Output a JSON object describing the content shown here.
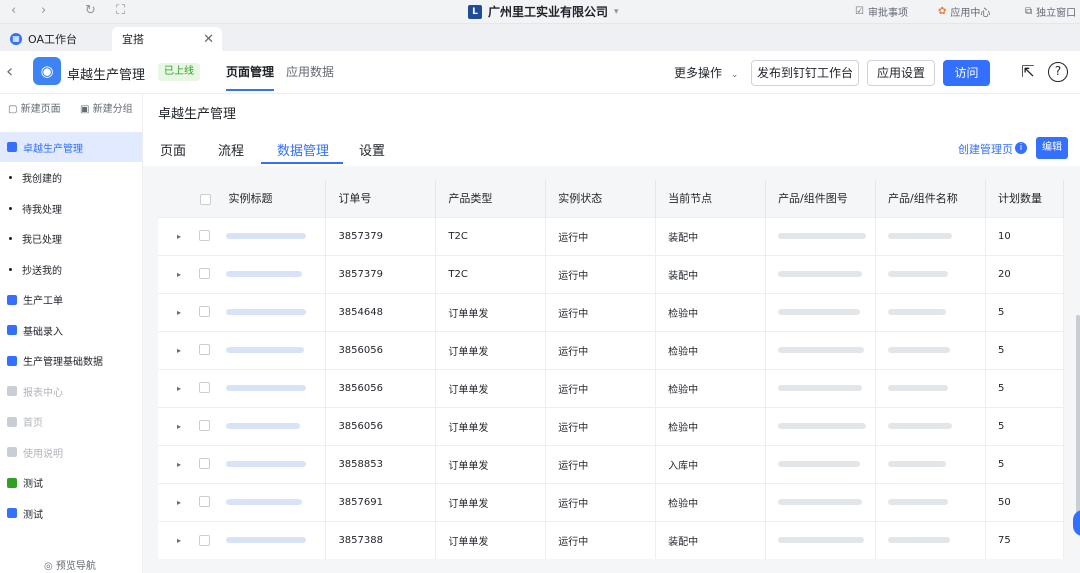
{
  "titlebar": {
    "company": "广州里工实业有限公司",
    "right_items": [
      {
        "label": "审批事项",
        "icon": "approval-icon"
      },
      {
        "label": "应用中心",
        "icon": "app-center-icon"
      },
      {
        "label": "独立窗口",
        "icon": "window-icon"
      }
    ]
  },
  "tabs": [
    {
      "label": "OA工作台",
      "active": false
    },
    {
      "label": "宜搭",
      "active": true
    }
  ],
  "header": {
    "app_name": "卓越生产管理",
    "status_badge": "已上线",
    "nav": [
      {
        "label": "页面管理",
        "active": true
      },
      {
        "label": "应用数据",
        "active": false
      }
    ],
    "more_label": "更多操作",
    "publish_label": "发布到钉钉工作台",
    "settings_label": "应用设置",
    "visit_label": "访问"
  },
  "sidebar": {
    "new_page": "新建页面",
    "new_group": "新建分组",
    "items": [
      {
        "label": "卓越生产管理",
        "type": "group",
        "active": true
      },
      {
        "label": "我创建的",
        "type": "dot"
      },
      {
        "label": "待我处理",
        "type": "dot"
      },
      {
        "label": "我已处理",
        "type": "dot"
      },
      {
        "label": "抄送我的",
        "type": "dot"
      },
      {
        "label": "生产工单",
        "type": "doc"
      },
      {
        "label": "基础录入",
        "type": "folder"
      },
      {
        "label": "生产管理基础数据",
        "type": "folder"
      },
      {
        "label": "报表中心",
        "type": "folder",
        "disabled": true
      },
      {
        "label": "首页",
        "type": "doc",
        "disabled": true
      },
      {
        "label": "使用说明",
        "type": "doc",
        "disabled": true
      },
      {
        "label": "测试",
        "type": "form"
      },
      {
        "label": "测试",
        "type": "doc"
      }
    ],
    "footer": "预览导航"
  },
  "main": {
    "title": "卓越生产管理",
    "subtabs": [
      "页面",
      "流程",
      "数据管理",
      "设置"
    ],
    "active_subtab": "数据管理",
    "create_label": "创建管理页",
    "edit_label": "编辑"
  },
  "table": {
    "columns": [
      "实例标题",
      "订单号",
      "产品类型",
      "实例状态",
      "当前节点",
      "产品/组件图号",
      "产品/组件名称",
      "计划数量"
    ],
    "rows": [
      {
        "order": "3857379",
        "type": "T2C",
        "status": "运行中",
        "node": "装配中",
        "qty": "10"
      },
      {
        "order": "3857379",
        "type": "T2C",
        "status": "运行中",
        "node": "装配中",
        "qty": "20"
      },
      {
        "order": "3854648",
        "type": "订单单发",
        "status": "运行中",
        "node": "检验中",
        "qty": "5"
      },
      {
        "order": "3856056",
        "type": "订单单发",
        "status": "运行中",
        "node": "检验中",
        "qty": "5"
      },
      {
        "order": "3856056",
        "type": "订单单发",
        "status": "运行中",
        "node": "检验中",
        "qty": "5"
      },
      {
        "order": "3856056",
        "type": "订单单发",
        "status": "运行中",
        "node": "检验中",
        "qty": "5"
      },
      {
        "order": "3858853",
        "type": "订单单发",
        "status": "运行中",
        "node": "入库中",
        "qty": "5"
      },
      {
        "order": "3857691",
        "type": "订单单发",
        "status": "运行中",
        "node": "检验中",
        "qty": "50"
      },
      {
        "order": "3857388",
        "type": "订单单发",
        "status": "运行中",
        "node": "装配中",
        "qty": "75"
      }
    ]
  }
}
